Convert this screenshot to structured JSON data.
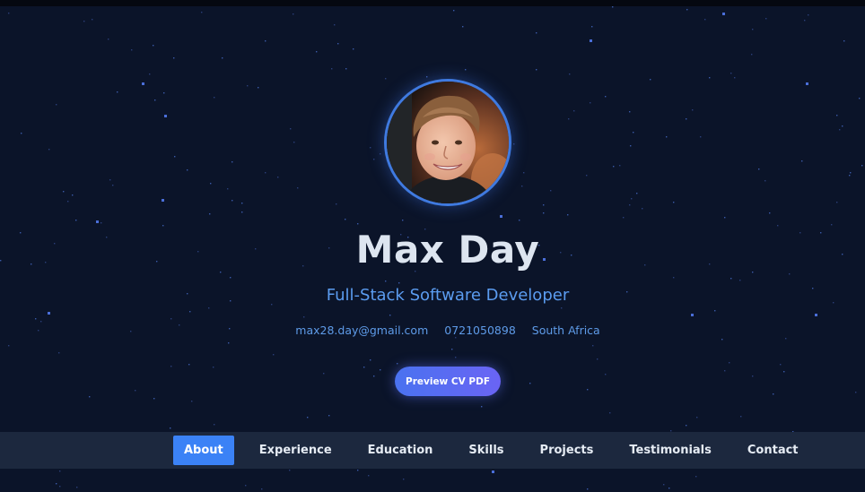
{
  "profile": {
    "name": "Max Day",
    "title": "Full-Stack Software Developer",
    "email": "max28.day@gmail.com",
    "phone": "0721050898",
    "location": "South Africa"
  },
  "cv_button": {
    "label": "Preview CV PDF"
  },
  "nav": {
    "items": [
      {
        "label": "About",
        "active": true
      },
      {
        "label": "Experience",
        "active": false
      },
      {
        "label": "Education",
        "active": false
      },
      {
        "label": "Skills",
        "active": false
      },
      {
        "label": "Projects",
        "active": false
      },
      {
        "label": "Testimonials",
        "active": false
      },
      {
        "label": "Contact",
        "active": false
      }
    ]
  },
  "colors": {
    "background": "#0b1429",
    "accent": "#3b82f6",
    "subtitle": "#5b9cf0",
    "nav_bar": "#1c283e",
    "avatar_border": "#3f7ae0"
  },
  "icons": [
    "profile-photo",
    "star-dot"
  ]
}
